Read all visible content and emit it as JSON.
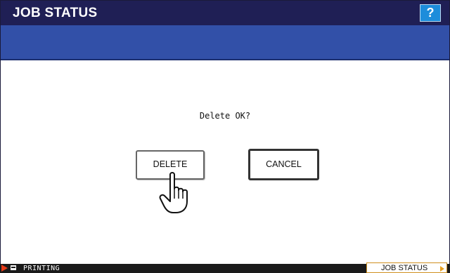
{
  "window": {
    "title": "JOB STATUS",
    "help_label": "?"
  },
  "dialog": {
    "prompt": "Delete OK?",
    "delete_label": "DELETE",
    "cancel_label": "CANCEL"
  },
  "statusbar": {
    "status_text": "PRINTING",
    "job_status_tab": "JOB STATUS"
  },
  "colors": {
    "titlebar": "#1f1f55",
    "band": "#3250a8",
    "help_button": "#1d8ddb",
    "status_arrow": "#e73a18",
    "tab_border": "#d09020"
  },
  "icons": [
    "help-icon",
    "hand-pointer-icon",
    "status-arrow-icon",
    "printer-icon",
    "tab-corner-arrow-icon"
  ]
}
